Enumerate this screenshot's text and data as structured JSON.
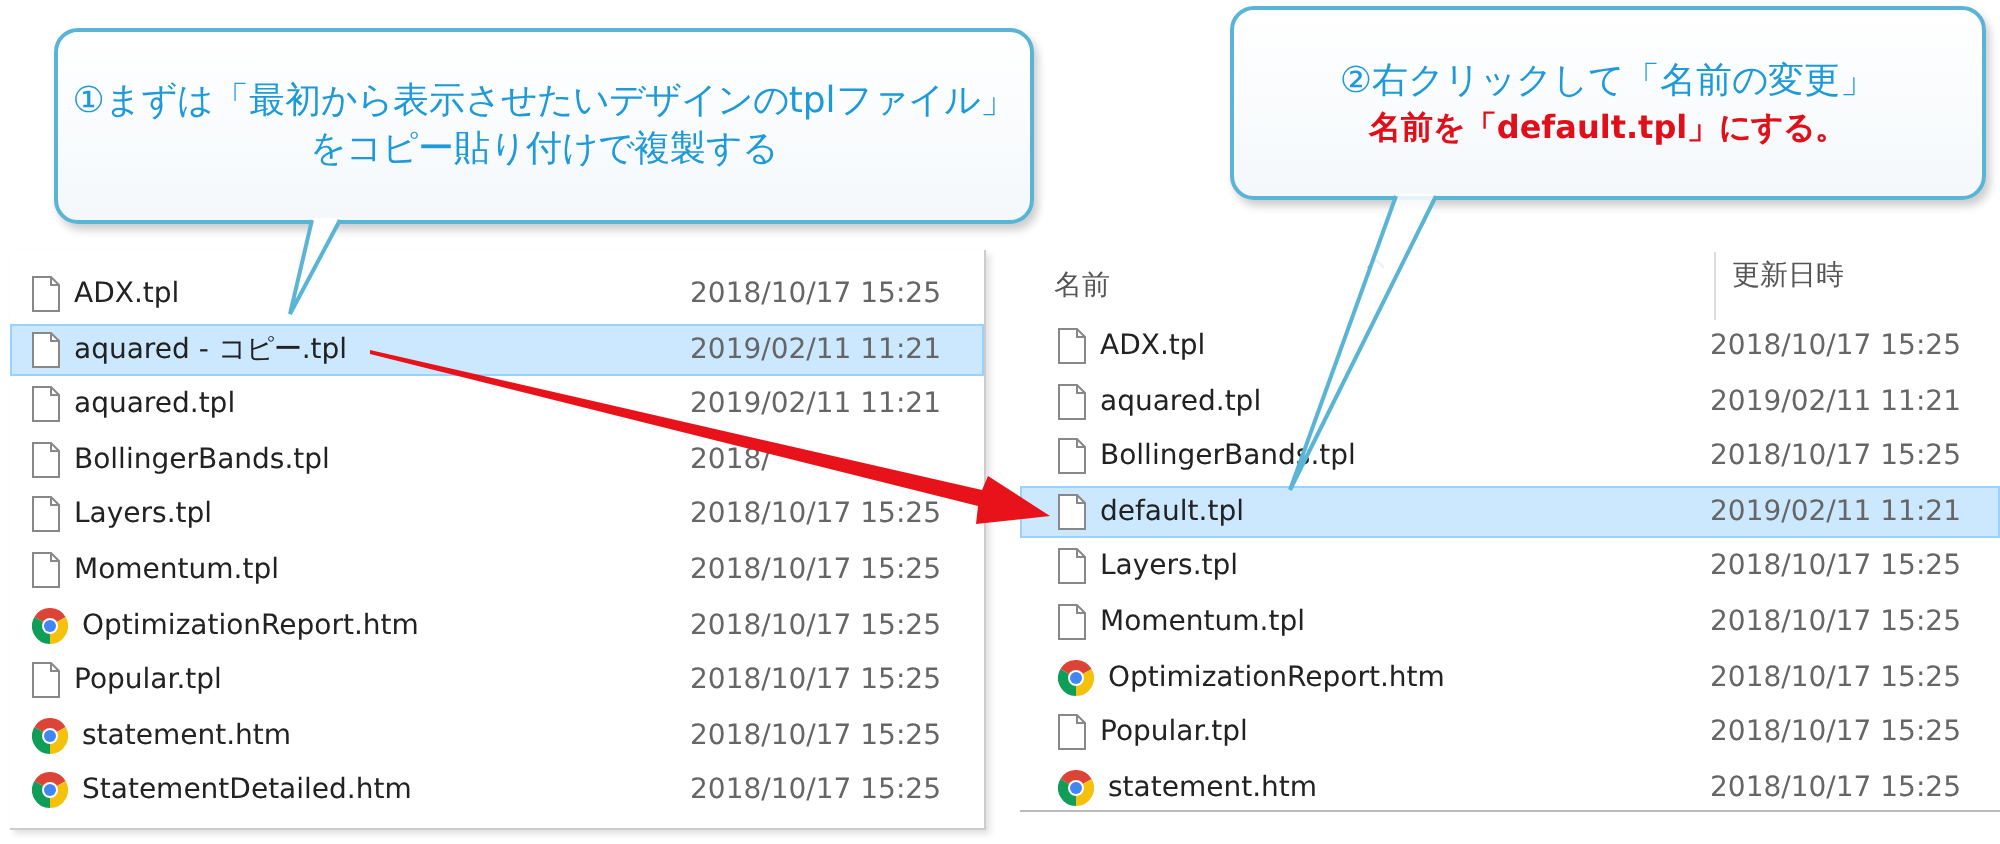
{
  "left_list": {
    "rows": [
      {
        "name": "ADX.tpl",
        "date": "2018/10/17 15:25",
        "kind": "file",
        "selected": false
      },
      {
        "name": "aquared - コピー.tpl",
        "date": "2019/02/11 11:21",
        "kind": "file",
        "selected": true
      },
      {
        "name": "aquared.tpl",
        "date": "2019/02/11 11:21",
        "kind": "file",
        "selected": false
      },
      {
        "name": "BollingerBands.tpl",
        "date": "2018/",
        "kind": "file",
        "selected": false
      },
      {
        "name": "Layers.tpl",
        "date": "2018/10/17 15:25",
        "kind": "file",
        "selected": false
      },
      {
        "name": "Momentum.tpl",
        "date": "2018/10/17 15:25",
        "kind": "file",
        "selected": false
      },
      {
        "name": "OptimizationReport.htm",
        "date": "2018/10/17 15:25",
        "kind": "chrome",
        "selected": false
      },
      {
        "name": "Popular.tpl",
        "date": "2018/10/17 15:25",
        "kind": "file",
        "selected": false
      },
      {
        "name": "statement.htm",
        "date": "2018/10/17 15:25",
        "kind": "chrome",
        "selected": false
      },
      {
        "name": "StatementDetailed.htm",
        "date": "2018/10/17 15:25",
        "kind": "chrome",
        "selected": false
      }
    ]
  },
  "right_list": {
    "columns": [
      "名前",
      "更新日時"
    ],
    "rows": [
      {
        "name": "ADX.tpl",
        "date": "2018/10/17 15:25",
        "kind": "file",
        "selected": false
      },
      {
        "name": "aquared.tpl",
        "date": "2019/02/11 11:21",
        "kind": "file",
        "selected": false
      },
      {
        "name": "BollingerBands.tpl",
        "date": "2018/10/17 15:25",
        "kind": "file",
        "selected": false
      },
      {
        "name": "default.tpl",
        "date": "2019/02/11 11:21",
        "kind": "file",
        "selected": true
      },
      {
        "name": "Layers.tpl",
        "date": "2018/10/17 15:25",
        "kind": "file",
        "selected": false
      },
      {
        "name": "Momentum.tpl",
        "date": "2018/10/17 15:25",
        "kind": "file",
        "selected": false
      },
      {
        "name": "OptimizationReport.htm",
        "date": "2018/10/17 15:25",
        "kind": "chrome",
        "selected": false
      },
      {
        "name": "Popular.tpl",
        "date": "2018/10/17 15:25",
        "kind": "file",
        "selected": false
      },
      {
        "name": "statement.htm",
        "date": "2018/10/17 15:25",
        "kind": "chrome",
        "selected": false
      }
    ]
  },
  "callouts": [
    {
      "lines": [
        {
          "text": "①まずは「最初から表示させたいデザインのtplファイル」",
          "kind": "note"
        },
        {
          "text": "をコピー貼り付けで複製する",
          "kind": "note"
        }
      ]
    },
    {
      "lines": [
        {
          "text": "②右クリックして「名前の変更」",
          "kind": "note"
        },
        {
          "text": "名前を「default.tpl」にする。",
          "kind": "emphasis"
        }
      ]
    }
  ]
}
